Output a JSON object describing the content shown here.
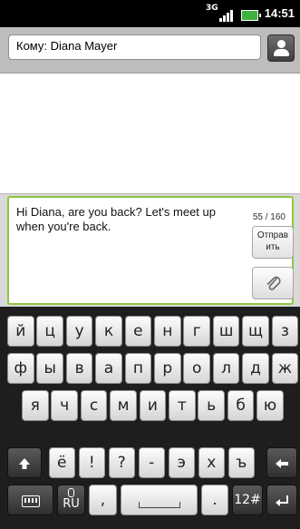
{
  "status_bar": {
    "network": "3G",
    "time": "14:51"
  },
  "recipient": {
    "to_field": "Кому: Diana Mayer"
  },
  "compose": {
    "message": "Hi Diana, are you back? Let's meet up when you're back.",
    "char_count": "55 / 160",
    "send_label": "Отправ ить"
  },
  "keyboard": {
    "row1": [
      "й",
      "ц",
      "у",
      "к",
      "е",
      "н",
      "г",
      "ш",
      "щ",
      "з"
    ],
    "row2": [
      "ф",
      "ы",
      "в",
      "а",
      "п",
      "р",
      "о",
      "л",
      "д",
      "ж"
    ],
    "row3": [
      "я",
      "ч",
      "с",
      "м",
      "и",
      "т",
      "ь",
      "б",
      "ю"
    ],
    "row4": [
      "ё",
      "!",
      "?",
      "-",
      "э",
      "х",
      "ъ"
    ],
    "language": "RU",
    "comma": ",",
    "period": ".",
    "symbols": "12#"
  },
  "colors": {
    "accent": "#8ec63f",
    "battery": "#3fb13f"
  }
}
